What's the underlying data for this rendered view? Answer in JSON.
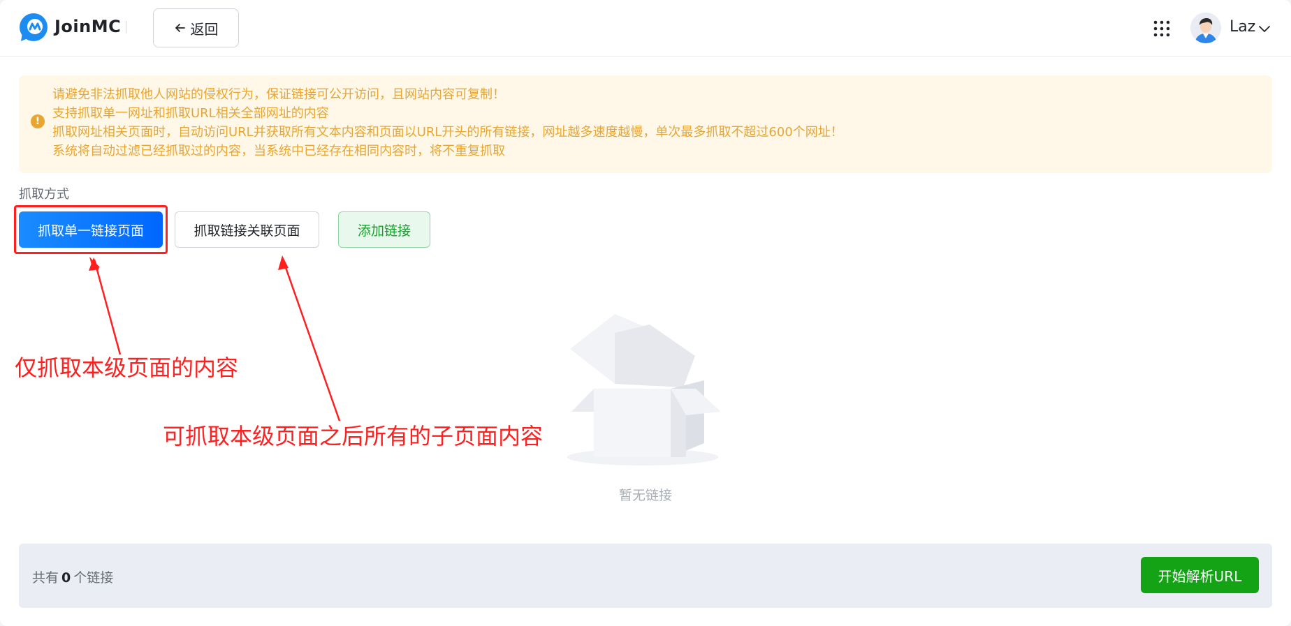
{
  "header": {
    "brand": "JoinMC",
    "back_label": "返回",
    "user_name": "Laz"
  },
  "notice": {
    "lines": [
      "请避免非法抓取他人网站的侵权行为，保证链接可公开访问，且网站内容可复制！",
      "支持抓取单一网址和抓取URL相关全部网址的内容",
      "抓取网址相关页面时，自动访问URL并获取所有文本内容和页面以URL开头的所有链接，网址越多速度越慢，单次最多抓取不超过600个网址！",
      "系统将自动过滤已经抓取过的内容，当系统中已经存在相同内容时，将不重复抓取"
    ]
  },
  "crawl": {
    "mode_label": "抓取方式",
    "single_label": "抓取单一链接页面",
    "related_label": "抓取链接关联页面",
    "add_label": "添加链接"
  },
  "annotations": {
    "single": "仅抓取本级页面的内容",
    "related": "可抓取本级页面之后所有的子页面内容"
  },
  "empty": {
    "text": "暂无链接"
  },
  "footer": {
    "count_prefix": "共有",
    "count": "0",
    "count_suffix": "个链接",
    "start_label": "开始解析URL"
  },
  "colors": {
    "primary": "#0a7bff",
    "success": "#15a316",
    "warning": "#e8a532",
    "annotation": "#ff1f1f"
  }
}
